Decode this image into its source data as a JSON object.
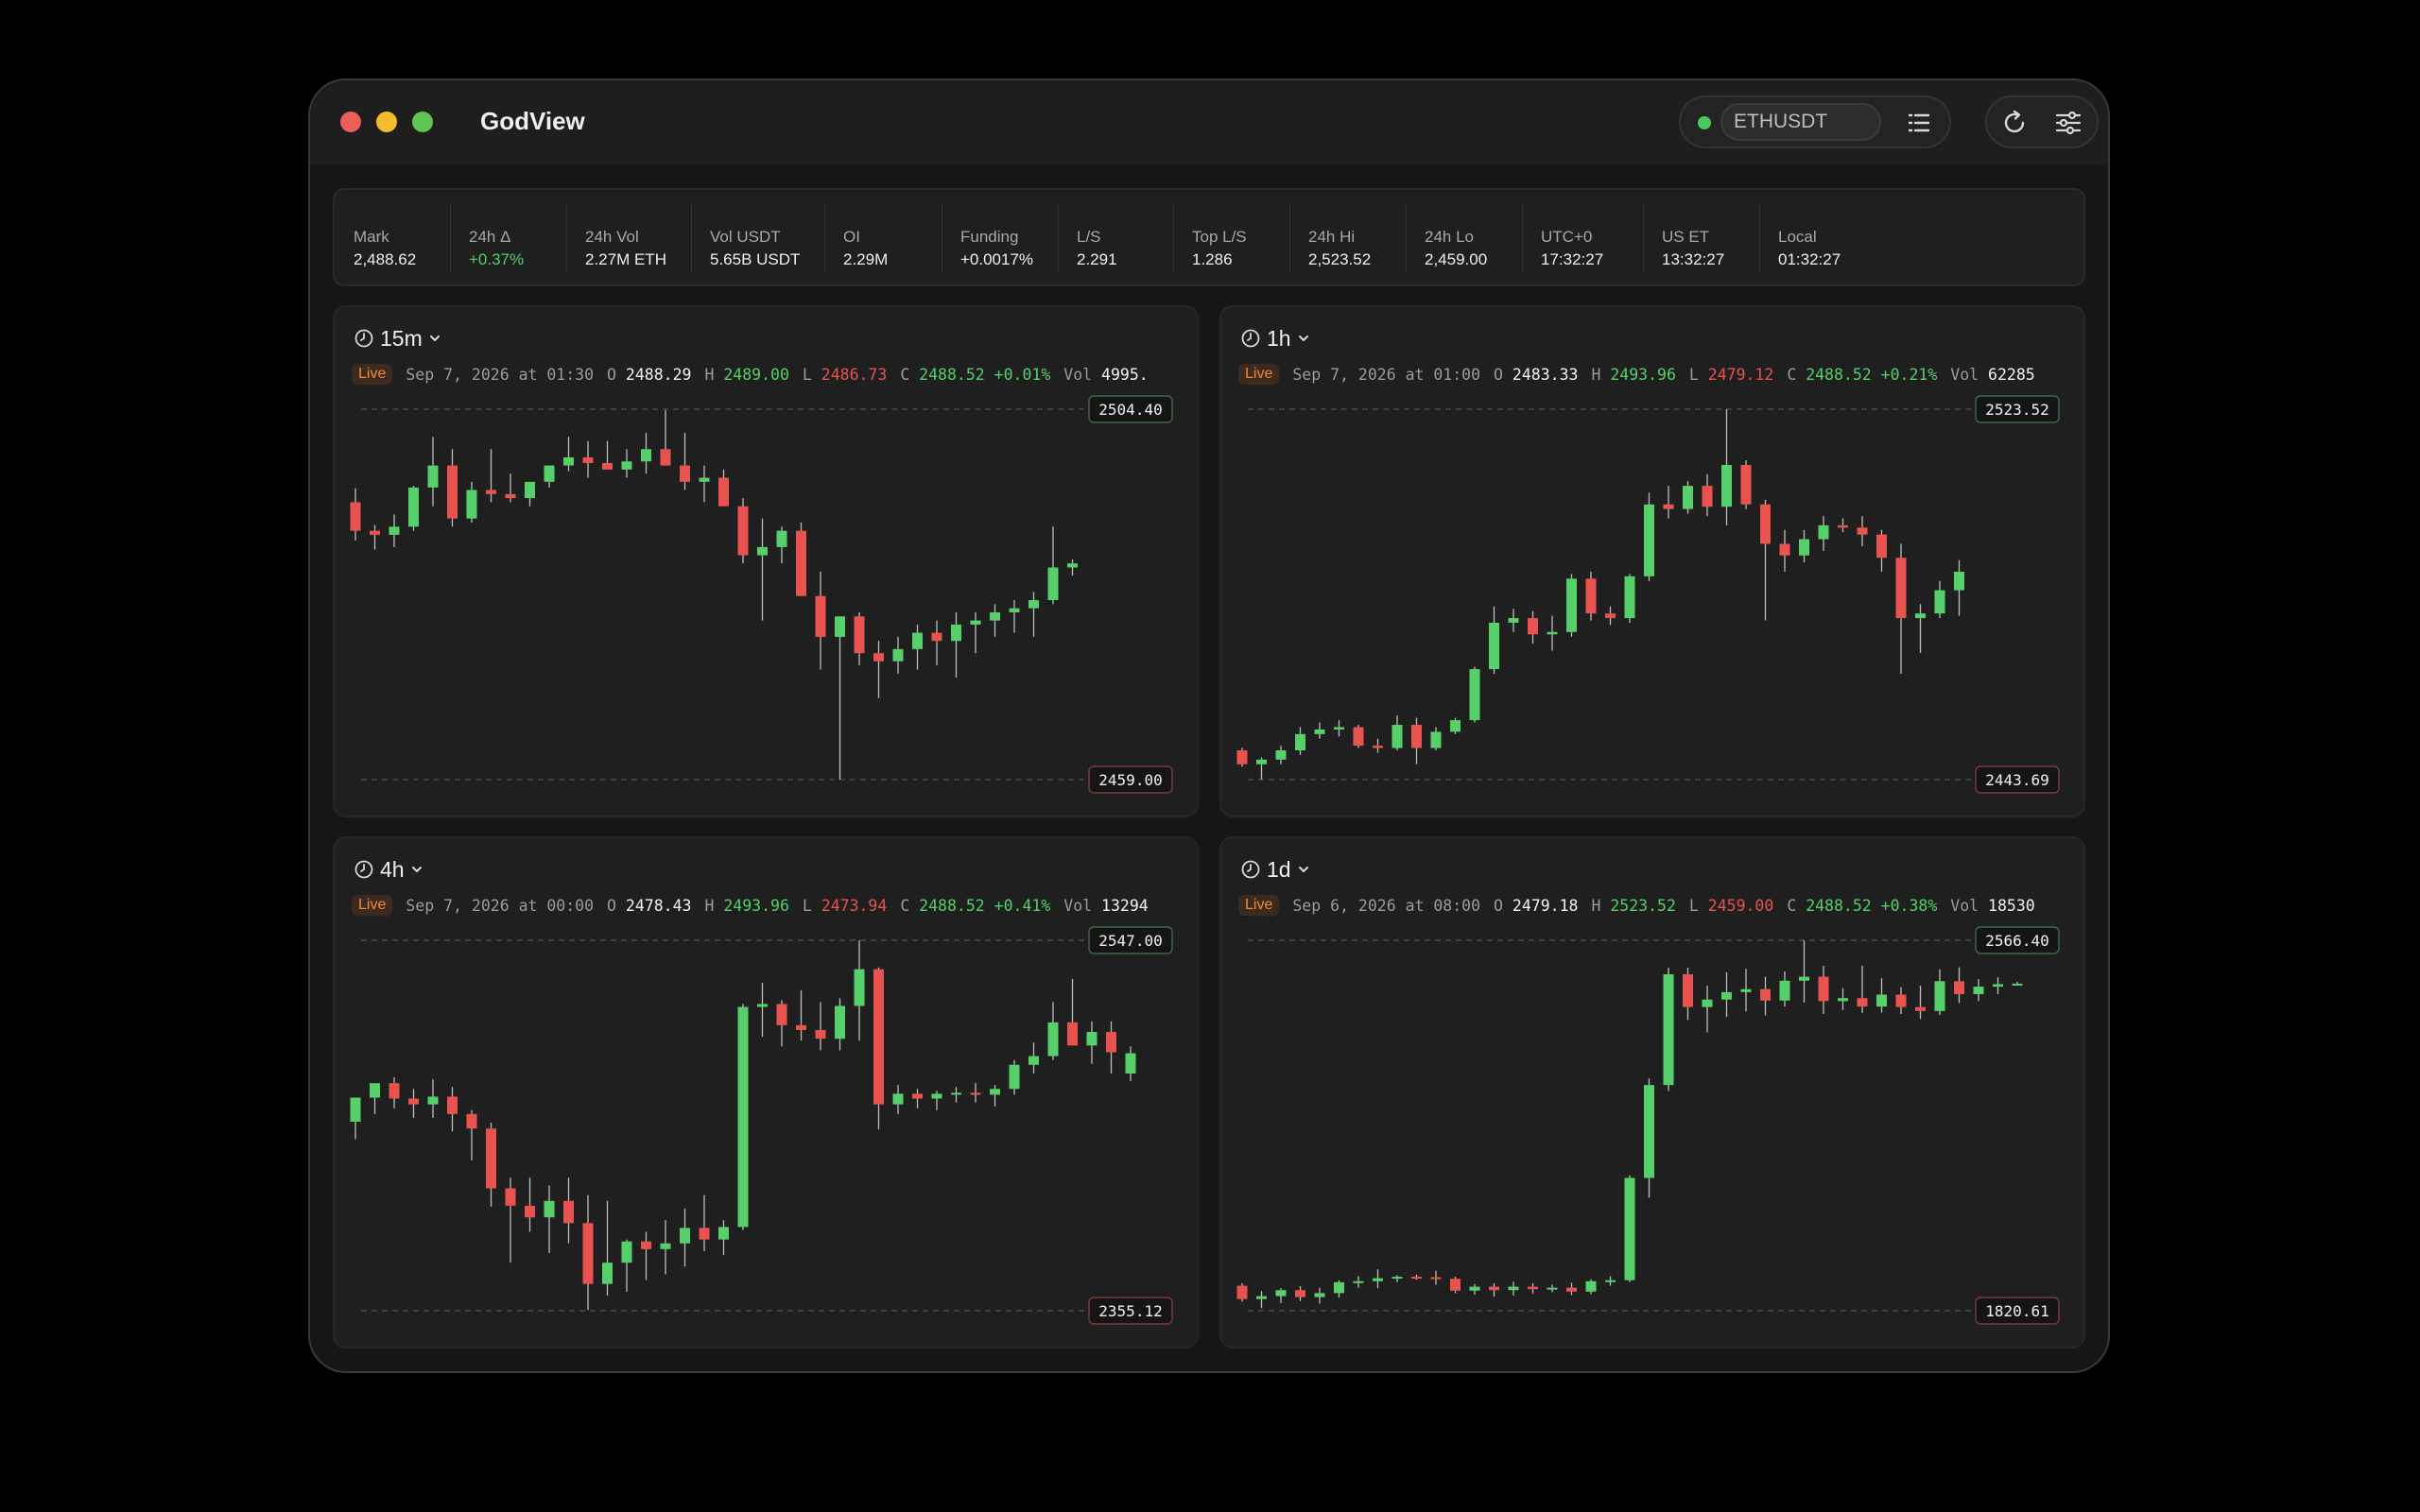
{
  "app": {
    "title": "GodView"
  },
  "symbol": {
    "value": "ETHUSDT",
    "status_color": "#47c85c"
  },
  "icons": {
    "list": "list-icon",
    "refresh": "refresh-icon",
    "settings": "sliders-icon",
    "clock": "clock-icon",
    "chevron": "chevron-down-icon"
  },
  "colors": {
    "up": "#55d06a",
    "down": "#e8524f",
    "live": "#f08a3c"
  },
  "stats": [
    {
      "label": "Mark",
      "value": "2,488.62"
    },
    {
      "label": "24h Δ",
      "value": "+0.37%",
      "positive": true
    },
    {
      "label": "24h Vol",
      "value": "2.27M ETH"
    },
    {
      "label": "Vol USDT",
      "value": "5.65B USDT"
    },
    {
      "label": "OI",
      "value": "2.29M"
    },
    {
      "label": "Funding",
      "value": "+0.0017%"
    },
    {
      "label": "L/S",
      "value": "2.291"
    },
    {
      "label": "Top L/S",
      "value": "1.286"
    },
    {
      "label": "24h Hi",
      "value": "2,523.52"
    },
    {
      "label": "24h Lo",
      "value": "2,459.00"
    },
    {
      "label": "UTC+0",
      "value": "17:32:27"
    },
    {
      "label": "US ET",
      "value": "13:32:27"
    },
    {
      "label": "Local",
      "value": "01:32:27"
    }
  ],
  "panels": [
    {
      "timeframe": "15m",
      "live": "Live",
      "datetime": "Sep 7, 2026 at 01:30",
      "o_label": "O",
      "o": "2488.29",
      "h_label": "H",
      "h": "2489.00",
      "l_label": "L",
      "l": "2486.73",
      "c_label": "C",
      "c": "2488.52",
      "change": "+0.01%",
      "vol_label": "Vol",
      "vol": "4995."
    },
    {
      "timeframe": "1h",
      "live": "Live",
      "datetime": "Sep 7, 2026 at 01:00",
      "o_label": "O",
      "o": "2483.33",
      "h_label": "H",
      "h": "2493.96",
      "l_label": "L",
      "l": "2479.12",
      "c_label": "C",
      "c": "2488.52",
      "change": "+0.21%",
      "vol_label": "Vol",
      "vol": "62285"
    },
    {
      "timeframe": "4h",
      "live": "Live",
      "datetime": "Sep 7, 2026 at 00:00",
      "o_label": "O",
      "o": "2478.43",
      "h_label": "H",
      "h": "2493.96",
      "l_label": "L",
      "l": "2473.94",
      "c_label": "C",
      "c": "2488.52",
      "change": "+0.41%",
      "vol_label": "Vol",
      "vol": "13294"
    },
    {
      "timeframe": "1d",
      "live": "Live",
      "datetime": "Sep 6, 2026 at 08:00",
      "o_label": "O",
      "o": "2479.18",
      "h_label": "H",
      "h": "2523.52",
      "l_label": "L",
      "l": "2459.00",
      "c_label": "C",
      "c": "2488.52",
      "change": "+0.38%",
      "vol_label": "Vol",
      "vol": "18530"
    }
  ],
  "chart_data": [
    {
      "type": "candlestick",
      "timeframe": "15m",
      "ylim": [
        2459.0,
        2504.4
      ],
      "high_label": "2504.40",
      "low_label": "2459.00",
      "candles": [
        [
          2493.0,
          2494.7,
          2488.3,
          2489.5
        ],
        [
          2489.5,
          2490.2,
          2487.2,
          2489.0
        ],
        [
          2489.0,
          2491.5,
          2487.5,
          2490.0
        ],
        [
          2490.0,
          2495.0,
          2489.5,
          2494.8
        ],
        [
          2494.8,
          2501.0,
          2492.5,
          2497.5
        ],
        [
          2497.5,
          2499.5,
          2490.0,
          2491.0
        ],
        [
          2491.0,
          2495.5,
          2490.5,
          2494.5
        ],
        [
          2494.5,
          2499.5,
          2493.0,
          2494.0
        ],
        [
          2494.0,
          2496.5,
          2493.0,
          2493.5
        ],
        [
          2493.5,
          2495.0,
          2492.5,
          2495.5
        ],
        [
          2495.5,
          2497.5,
          2494.8,
          2497.5
        ],
        [
          2497.5,
          2501.0,
          2496.8,
          2498.5
        ],
        [
          2498.5,
          2500.5,
          2496.0,
          2497.8
        ],
        [
          2497.8,
          2500.5,
          2497.0,
          2497.0
        ],
        [
          2497.0,
          2499.5,
          2496.0,
          2498.0
        ],
        [
          2498.0,
          2501.5,
          2496.5,
          2499.5
        ],
        [
          2499.5,
          2504.3,
          2497.5,
          2497.5
        ],
        [
          2497.5,
          2501.5,
          2494.5,
          2495.5
        ],
        [
          2495.5,
          2497.5,
          2493.0,
          2496.0
        ],
        [
          2496.0,
          2497.0,
          2492.5,
          2492.5
        ],
        [
          2492.5,
          2493.5,
          2485.5,
          2486.5
        ],
        [
          2486.5,
          2491.0,
          2478.5,
          2487.5
        ],
        [
          2487.5,
          2490.0,
          2485.5,
          2489.5
        ],
        [
          2489.5,
          2490.5,
          2481.5,
          2481.5
        ],
        [
          2481.5,
          2484.5,
          2472.5,
          2476.5
        ],
        [
          2476.5,
          2479.0,
          2459.0,
          2479.0
        ],
        [
          2479.0,
          2479.5,
          2473.0,
          2474.5
        ],
        [
          2474.5,
          2476.0,
          2469.0,
          2473.5
        ],
        [
          2473.5,
          2476.5,
          2472.0,
          2475.0
        ],
        [
          2475.0,
          2478.0,
          2472.5,
          2477.0
        ],
        [
          2477.0,
          2478.5,
          2473.0,
          2476.0
        ],
        [
          2476.0,
          2479.5,
          2471.5,
          2478.0
        ],
        [
          2478.0,
          2479.5,
          2474.5,
          2478.5
        ],
        [
          2478.5,
          2480.5,
          2476.5,
          2479.5
        ],
        [
          2479.5,
          2481.0,
          2477.0,
          2480.0
        ],
        [
          2480.0,
          2482.0,
          2476.5,
          2481.0
        ],
        [
          2481.0,
          2490.0,
          2480.5,
          2485.0
        ],
        [
          2485.0,
          2486.0,
          2484.0,
          2485.5
        ]
      ]
    },
    {
      "type": "candlestick",
      "timeframe": "1h",
      "ylim": [
        2443.69,
        2523.52
      ],
      "high_label": "2523.52",
      "low_label": "2443.69",
      "candles": [
        [
          2450.0,
          2450.5,
          2446.5,
          2447.0
        ],
        [
          2447.0,
          2448.5,
          2443.7,
          2448.0
        ],
        [
          2448.0,
          2451.0,
          2447.0,
          2450.0
        ],
        [
          2450.0,
          2455.0,
          2449.0,
          2453.5
        ],
        [
          2453.5,
          2456.0,
          2452.5,
          2454.5
        ],
        [
          2454.5,
          2456.5,
          2453.0,
          2455.0
        ],
        [
          2455.0,
          2455.5,
          2450.5,
          2451.0
        ],
        [
          2451.0,
          2452.5,
          2449.5,
          2450.5
        ],
        [
          2450.5,
          2457.5,
          2450.0,
          2455.5
        ],
        [
          2455.5,
          2457.0,
          2447.0,
          2450.5
        ],
        [
          2450.5,
          2455.0,
          2450.0,
          2454.0
        ],
        [
          2454.0,
          2457.0,
          2453.5,
          2456.5
        ],
        [
          2456.5,
          2468.0,
          2456.0,
          2467.5
        ],
        [
          2467.5,
          2481.0,
          2466.5,
          2477.5
        ],
        [
          2477.5,
          2480.5,
          2475.5,
          2478.5
        ],
        [
          2478.5,
          2480.0,
          2473.0,
          2475.0
        ],
        [
          2475.0,
          2479.0,
          2471.5,
          2475.5
        ],
        [
          2475.5,
          2488.0,
          2474.5,
          2487.0
        ],
        [
          2487.0,
          2488.5,
          2478.0,
          2479.5
        ],
        [
          2479.5,
          2481.0,
          2477.0,
          2478.5
        ],
        [
          2478.5,
          2488.0,
          2477.5,
          2487.5
        ],
        [
          2487.5,
          2505.5,
          2486.5,
          2503.0
        ],
        [
          2503.0,
          2507.0,
          2500.0,
          2502.0
        ],
        [
          2502.0,
          2508.0,
          2501.0,
          2507.0
        ],
        [
          2507.0,
          2509.5,
          2500.5,
          2502.5
        ],
        [
          2502.5,
          2523.5,
          2498.5,
          2511.5
        ],
        [
          2511.5,
          2512.5,
          2502.0,
          2503.0
        ],
        [
          2503.0,
          2504.0,
          2478.0,
          2494.5
        ],
        [
          2494.5,
          2497.5,
          2488.5,
          2492.0
        ],
        [
          2492.0,
          2497.5,
          2490.5,
          2495.5
        ],
        [
          2495.5,
          2500.5,
          2493.0,
          2498.5
        ],
        [
          2498.5,
          2500.0,
          2497.0,
          2498.0
        ],
        [
          2498.0,
          2500.5,
          2494.0,
          2496.5
        ],
        [
          2496.5,
          2497.5,
          2488.5,
          2491.5
        ],
        [
          2491.5,
          2494.5,
          2466.5,
          2478.5
        ],
        [
          2478.5,
          2481.5,
          2471.0,
          2479.5
        ],
        [
          2479.5,
          2486.5,
          2478.5,
          2484.5
        ],
        [
          2484.5,
          2491.0,
          2479.0,
          2488.5
        ]
      ]
    },
    {
      "type": "candlestick",
      "timeframe": "4h",
      "ylim": [
        2355.12,
        2547.0
      ],
      "high_label": "2547.00",
      "low_label": "2355.12",
      "candles": [
        [
          2453.0,
          2463.0,
          2444.0,
          2465.5
        ],
        [
          2465.5,
          2472.0,
          2457.0,
          2473.0
        ],
        [
          2473.0,
          2476.0,
          2460.0,
          2465.0
        ],
        [
          2465.0,
          2470.0,
          2455.0,
          2462.0
        ],
        [
          2462.0,
          2475.0,
          2455.0,
          2466.0
        ],
        [
          2466.0,
          2471.0,
          2448.0,
          2457.0
        ],
        [
          2457.0,
          2459.0,
          2433.0,
          2449.5
        ],
        [
          2449.5,
          2452.5,
          2409.0,
          2418.5
        ],
        [
          2418.5,
          2424.0,
          2380.0,
          2409.5
        ],
        [
          2409.5,
          2424.0,
          2396.0,
          2403.5
        ],
        [
          2403.5,
          2420.0,
          2385.0,
          2412.0
        ],
        [
          2412.0,
          2424.0,
          2390.0,
          2400.5
        ],
        [
          2400.5,
          2415.0,
          2355.5,
          2369.0
        ],
        [
          2369.0,
          2412.0,
          2363.0,
          2380.0
        ],
        [
          2380.0,
          2392.0,
          2365.0,
          2391.0
        ],
        [
          2391.0,
          2396.0,
          2371.0,
          2387.0
        ],
        [
          2387.0,
          2402.0,
          2374.0,
          2390.0
        ],
        [
          2390.0,
          2408.0,
          2378.0,
          2398.0
        ],
        [
          2398.0,
          2415.0,
          2386.0,
          2392.0
        ],
        [
          2392.0,
          2402.0,
          2384.0,
          2398.5
        ],
        [
          2398.5,
          2514.0,
          2397.0,
          2512.5
        ],
        [
          2512.5,
          2525.0,
          2497.0,
          2514.0
        ],
        [
          2514.0,
          2516.0,
          2492.0,
          2503.0
        ],
        [
          2503.0,
          2521.0,
          2495.0,
          2500.5
        ],
        [
          2500.5,
          2515.0,
          2490.0,
          2496.0
        ],
        [
          2496.0,
          2517.0,
          2490.0,
          2513.0
        ],
        [
          2513.0,
          2547.0,
          2495.0,
          2532.0
        ],
        [
          2532.0,
          2533.0,
          2449.0,
          2462.0
        ],
        [
          2462.0,
          2472.0,
          2457.0,
          2467.5
        ],
        [
          2467.5,
          2470.0,
          2460.0,
          2465.0
        ],
        [
          2465.0,
          2469.0,
          2459.0,
          2467.5
        ],
        [
          2467.5,
          2471.0,
          2463.0,
          2468.0
        ],
        [
          2468.0,
          2473.0,
          2463.0,
          2467.0
        ],
        [
          2467.0,
          2472.0,
          2461.0,
          2470.0
        ],
        [
          2470.0,
          2485.0,
          2467.0,
          2482.5
        ],
        [
          2482.5,
          2494.0,
          2478.0,
          2487.0
        ],
        [
          2487.0,
          2515.0,
          2485.0,
          2504.5
        ],
        [
          2504.5,
          2527.0,
          2497.0,
          2492.5
        ],
        [
          2492.5,
          2505.0,
          2483.0,
          2499.5
        ],
        [
          2499.5,
          2505.0,
          2478.0,
          2489.0
        ],
        [
          2478.0,
          2492.0,
          2474.0,
          2488.5
        ]
      ]
    },
    {
      "type": "candlestick",
      "timeframe": "1d",
      "ylim": [
        1820.61,
        2566.4
      ],
      "high_label": "2566.40",
      "low_label": "1820.61",
      "candles": [
        [
          1871.0,
          1876.0,
          1839.0,
          1844.0
        ],
        [
          1844.0,
          1860.0,
          1826.0,
          1850.0
        ],
        [
          1850.0,
          1866.0,
          1836.0,
          1862.0
        ],
        [
          1862.0,
          1870.0,
          1840.0,
          1848.0
        ],
        [
          1848.0,
          1867.0,
          1835.0,
          1856.0
        ],
        [
          1856.0,
          1882.0,
          1847.0,
          1878.0
        ],
        [
          1878.0,
          1890.0,
          1867.0,
          1880.0
        ],
        [
          1880.0,
          1904.0,
          1866.0,
          1886.0
        ],
        [
          1886.0,
          1892.0,
          1878.0,
          1889.0
        ],
        [
          1889.0,
          1893.0,
          1883.0,
          1888.0
        ],
        [
          1888.0,
          1901.0,
          1873.0,
          1885.0
        ],
        [
          1885.0,
          1889.0,
          1856.0,
          1861.0
        ],
        [
          1861.0,
          1874.0,
          1853.0,
          1869.0
        ],
        [
          1869.0,
          1876.0,
          1849.0,
          1862.0
        ],
        [
          1862.0,
          1879.0,
          1851.0,
          1869.0
        ],
        [
          1869.0,
          1876.0,
          1855.0,
          1864.0
        ],
        [
          1864.0,
          1873.0,
          1858.0,
          1867.0
        ],
        [
          1867.0,
          1877.0,
          1852.0,
          1859.0
        ],
        [
          1859.0,
          1884.0,
          1854.0,
          1880.0
        ],
        [
          1880.0,
          1890.0,
          1871.0,
          1882.0
        ],
        [
          1882.0,
          2093.0,
          1878.0,
          2088.0
        ],
        [
          2088.0,
          2288.0,
          2048.0,
          2275.0
        ],
        [
          2275.0,
          2511.0,
          2263.0,
          2498.0
        ],
        [
          2498.0,
          2511.0,
          2406.0,
          2432.0
        ],
        [
          2432.0,
          2475.0,
          2381.0,
          2447.0
        ],
        [
          2447.0,
          2502.0,
          2412.0,
          2462.0
        ],
        [
          2462.0,
          2509.0,
          2423.0,
          2468.0
        ],
        [
          2468.0,
          2493.0,
          2415.0,
          2445.0
        ],
        [
          2445.0,
          2504.0,
          2433.0,
          2485.0
        ],
        [
          2485.0,
          2566.0,
          2441.0,
          2493.0
        ],
        [
          2493.0,
          2515.0,
          2418.0,
          2444.0
        ],
        [
          2444.0,
          2470.0,
          2426.0,
          2450.0
        ],
        [
          2450.0,
          2515.0,
          2420.0,
          2433.0
        ],
        [
          2433.0,
          2490.0,
          2421.0,
          2457.0
        ],
        [
          2457.0,
          2472.0,
          2418.0,
          2432.0
        ],
        [
          2432.0,
          2475.0,
          2408.0,
          2424.0
        ],
        [
          2424.0,
          2508.0,
          2416.0,
          2484.0
        ],
        [
          2484.0,
          2512.0,
          2440.0,
          2458.0
        ],
        [
          2458.0,
          2488.0,
          2444.0,
          2473.0
        ],
        [
          2473.0,
          2492.0,
          2458.0,
          2478.0
        ],
        [
          2478.0,
          2483.0,
          2475.0,
          2479.0
        ]
      ]
    }
  ]
}
